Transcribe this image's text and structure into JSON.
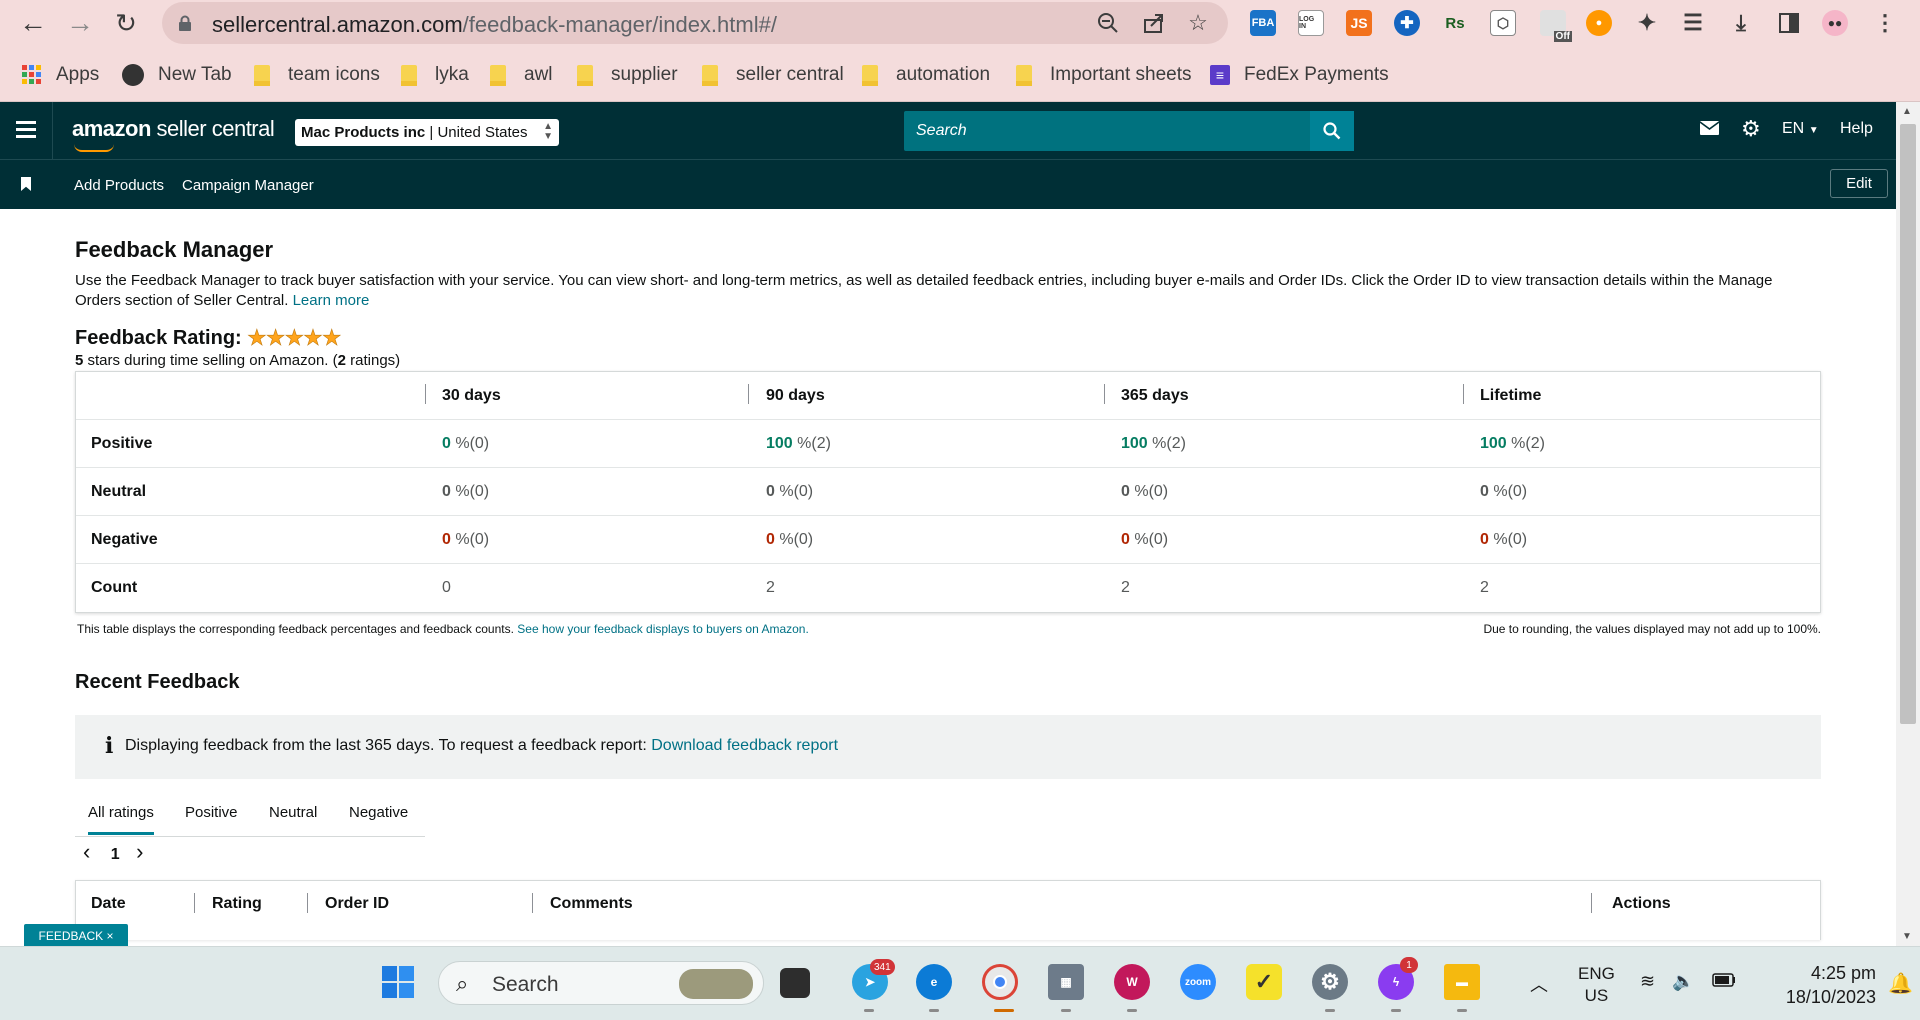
{
  "browser": {
    "url_host": "sellercentral.amazon.com",
    "url_path": "/feedback-manager/index.html#/",
    "extensions": [
      "FBA",
      "LOG IN",
      "JS",
      "Rs"
    ],
    "off_badge": "Off",
    "bookmarks": [
      "Apps",
      "New Tab",
      "team icons",
      "lyka",
      "awl",
      "supplier",
      "seller central",
      "automation",
      "Important sheets",
      "FedEx Payments"
    ]
  },
  "header": {
    "logo_brand": "amazon",
    "logo_product": " seller central",
    "account_name": "Mac Products inc",
    "account_sep": " | ",
    "account_region": "United States",
    "search_placeholder": "Search",
    "language": "EN",
    "help": "Help"
  },
  "subnav": {
    "links": [
      "Add Products",
      "Campaign Manager"
    ],
    "edit": "Edit"
  },
  "page": {
    "title": "Feedback Manager",
    "intro": "Use the Feedback Manager to track buyer satisfaction with your service. You can view short- and long-term metrics, as well as detailed feedback entries, including buyer e-mails and Order IDs. Click the Order ID to view transaction details within the Manage Orders section of Seller Central.",
    "learn_more": "Learn more",
    "rating_heading": "Feedback Rating:",
    "stars": "★★★★★",
    "rating_stars_value": 5,
    "summary_stars": "5",
    "summary_mid": " stars during time selling on Amazon. (",
    "summary_count": "2",
    "summary_end": " ratings)"
  },
  "metrics": {
    "columns": [
      "30 days",
      "90 days",
      "365 days",
      "Lifetime"
    ],
    "rows": [
      {
        "label": "Positive",
        "cells": [
          {
            "v": "0",
            "r": " %(0)"
          },
          {
            "v": "100",
            "r": " %(2)"
          },
          {
            "v": "100",
            "r": " %(2)"
          },
          {
            "v": "100",
            "r": " %(2)"
          }
        ]
      },
      {
        "label": "Neutral",
        "cells": [
          {
            "v": "0",
            "r": " %(0)"
          },
          {
            "v": "0",
            "r": " %(0)"
          },
          {
            "v": "0",
            "r": " %(0)"
          },
          {
            "v": "0",
            "r": " %(0)"
          }
        ]
      },
      {
        "label": "Negative",
        "cells": [
          {
            "v": "0",
            "r": " %(0)"
          },
          {
            "v": "0",
            "r": " %(0)"
          },
          {
            "v": "0",
            "r": " %(0)"
          },
          {
            "v": "0",
            "r": " %(0)"
          }
        ]
      },
      {
        "label": "Count",
        "cells": [
          {
            "v": "",
            "r": "0"
          },
          {
            "v": "",
            "r": "2"
          },
          {
            "v": "",
            "r": "2"
          },
          {
            "v": "",
            "r": "2"
          }
        ]
      }
    ],
    "note": "This table displays the corresponding feedback percentages and feedback counts.",
    "note_link": "See how your feedback displays to buyers on Amazon.",
    "rounding_note": "Due to rounding, the values displayed may not add up to 100%."
  },
  "recent": {
    "heading": "Recent Feedback",
    "info_icon": "i",
    "info_text": "Displaying feedback from the last 365 days. To request a feedback report:",
    "info_link": "Download feedback report",
    "tabs": [
      "All ratings",
      "Positive",
      "Neutral",
      "Negative"
    ],
    "page_prev": "‹",
    "page_number": "1",
    "page_next": "›",
    "table_headers": [
      "Date",
      "Rating",
      "Order ID",
      "Comments",
      "Actions"
    ]
  },
  "feedback_tab": "FEEDBACK ×",
  "taskbar": {
    "search": "Search",
    "telegram_badge": "341",
    "messenger_badge": "1",
    "zoom": "zoom",
    "lang_1": "ENG",
    "lang_2": "US",
    "time": "4:25 pm",
    "date": "18/10/2023"
  },
  "colors": {
    "header_bg": "#002f36",
    "search_bg": "#00727f",
    "positive": "#067d62",
    "negative": "#b12704",
    "link": "#007185"
  }
}
